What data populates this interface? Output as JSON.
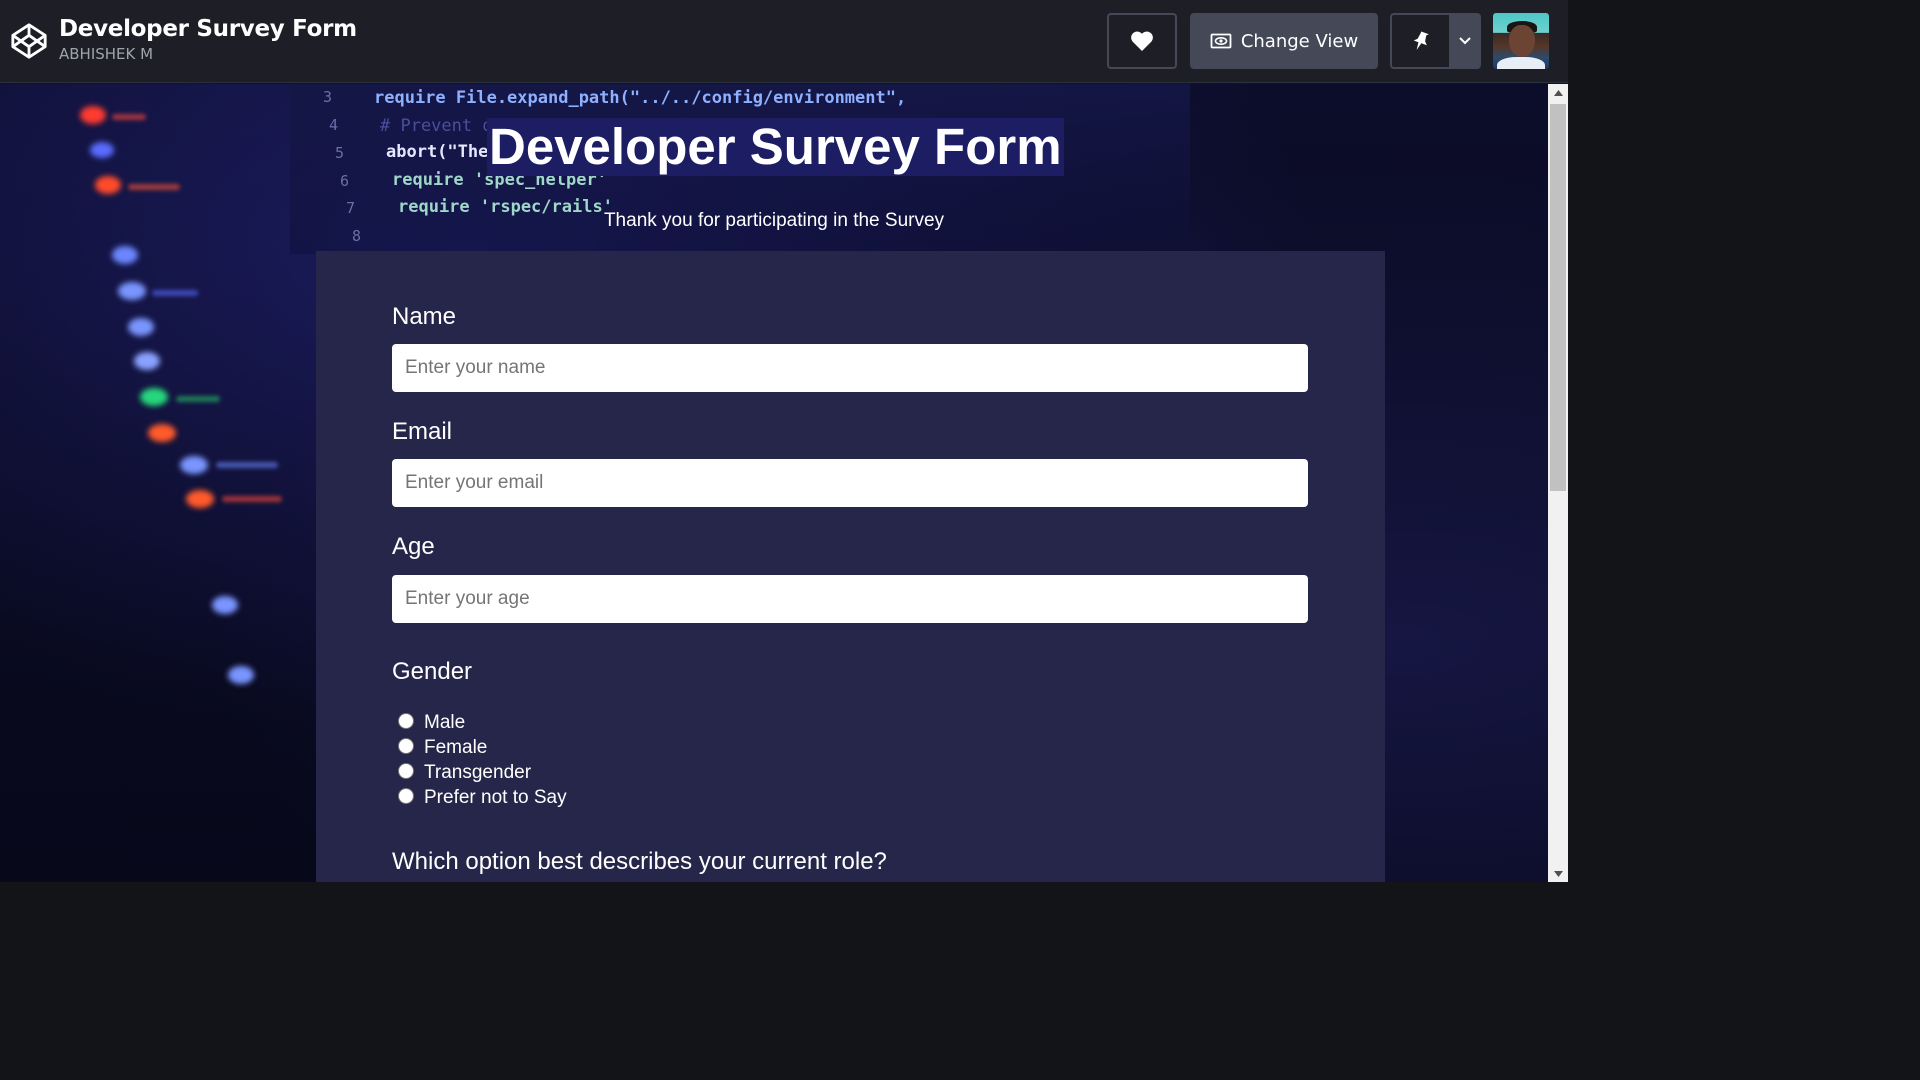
{
  "header": {
    "pen_title": "Developer Survey Form",
    "author": "ABHISHEK M",
    "change_view_label": "Change View",
    "icons": [
      "codepen-logo-icon",
      "heart-icon",
      "eye-icon",
      "pin-icon",
      "chevron-down-icon"
    ]
  },
  "page": {
    "title": "Developer Survey Form",
    "subtitle": "Thank you for participating in the Survey"
  },
  "background_code": {
    "lines": [
      "require File.expand_path(\"../../config/environment\",",
      "# Prevent d",
      "abort(\"The",
      "require 'spec_helper'",
      "require 'rspec/rails'"
    ],
    "line_numbers": [
      "3",
      "4",
      "5",
      "6",
      "7",
      "8"
    ]
  },
  "form": {
    "name": {
      "label": "Name",
      "placeholder": "Enter your name",
      "value": ""
    },
    "email": {
      "label": "Email",
      "placeholder": "Enter your email",
      "value": ""
    },
    "age": {
      "label": "Age",
      "placeholder": "Enter your age",
      "value": ""
    },
    "gender": {
      "label": "Gender",
      "options": [
        "Male",
        "Female",
        "Transgender",
        "Prefer not to Say"
      ]
    },
    "role_question": "Which option best describes your current role?"
  },
  "colors": {
    "header_bg": "#1e1f26",
    "button_bg": "#444857",
    "card_bg": "#26264a",
    "title_highlight": "#1c1d63"
  }
}
